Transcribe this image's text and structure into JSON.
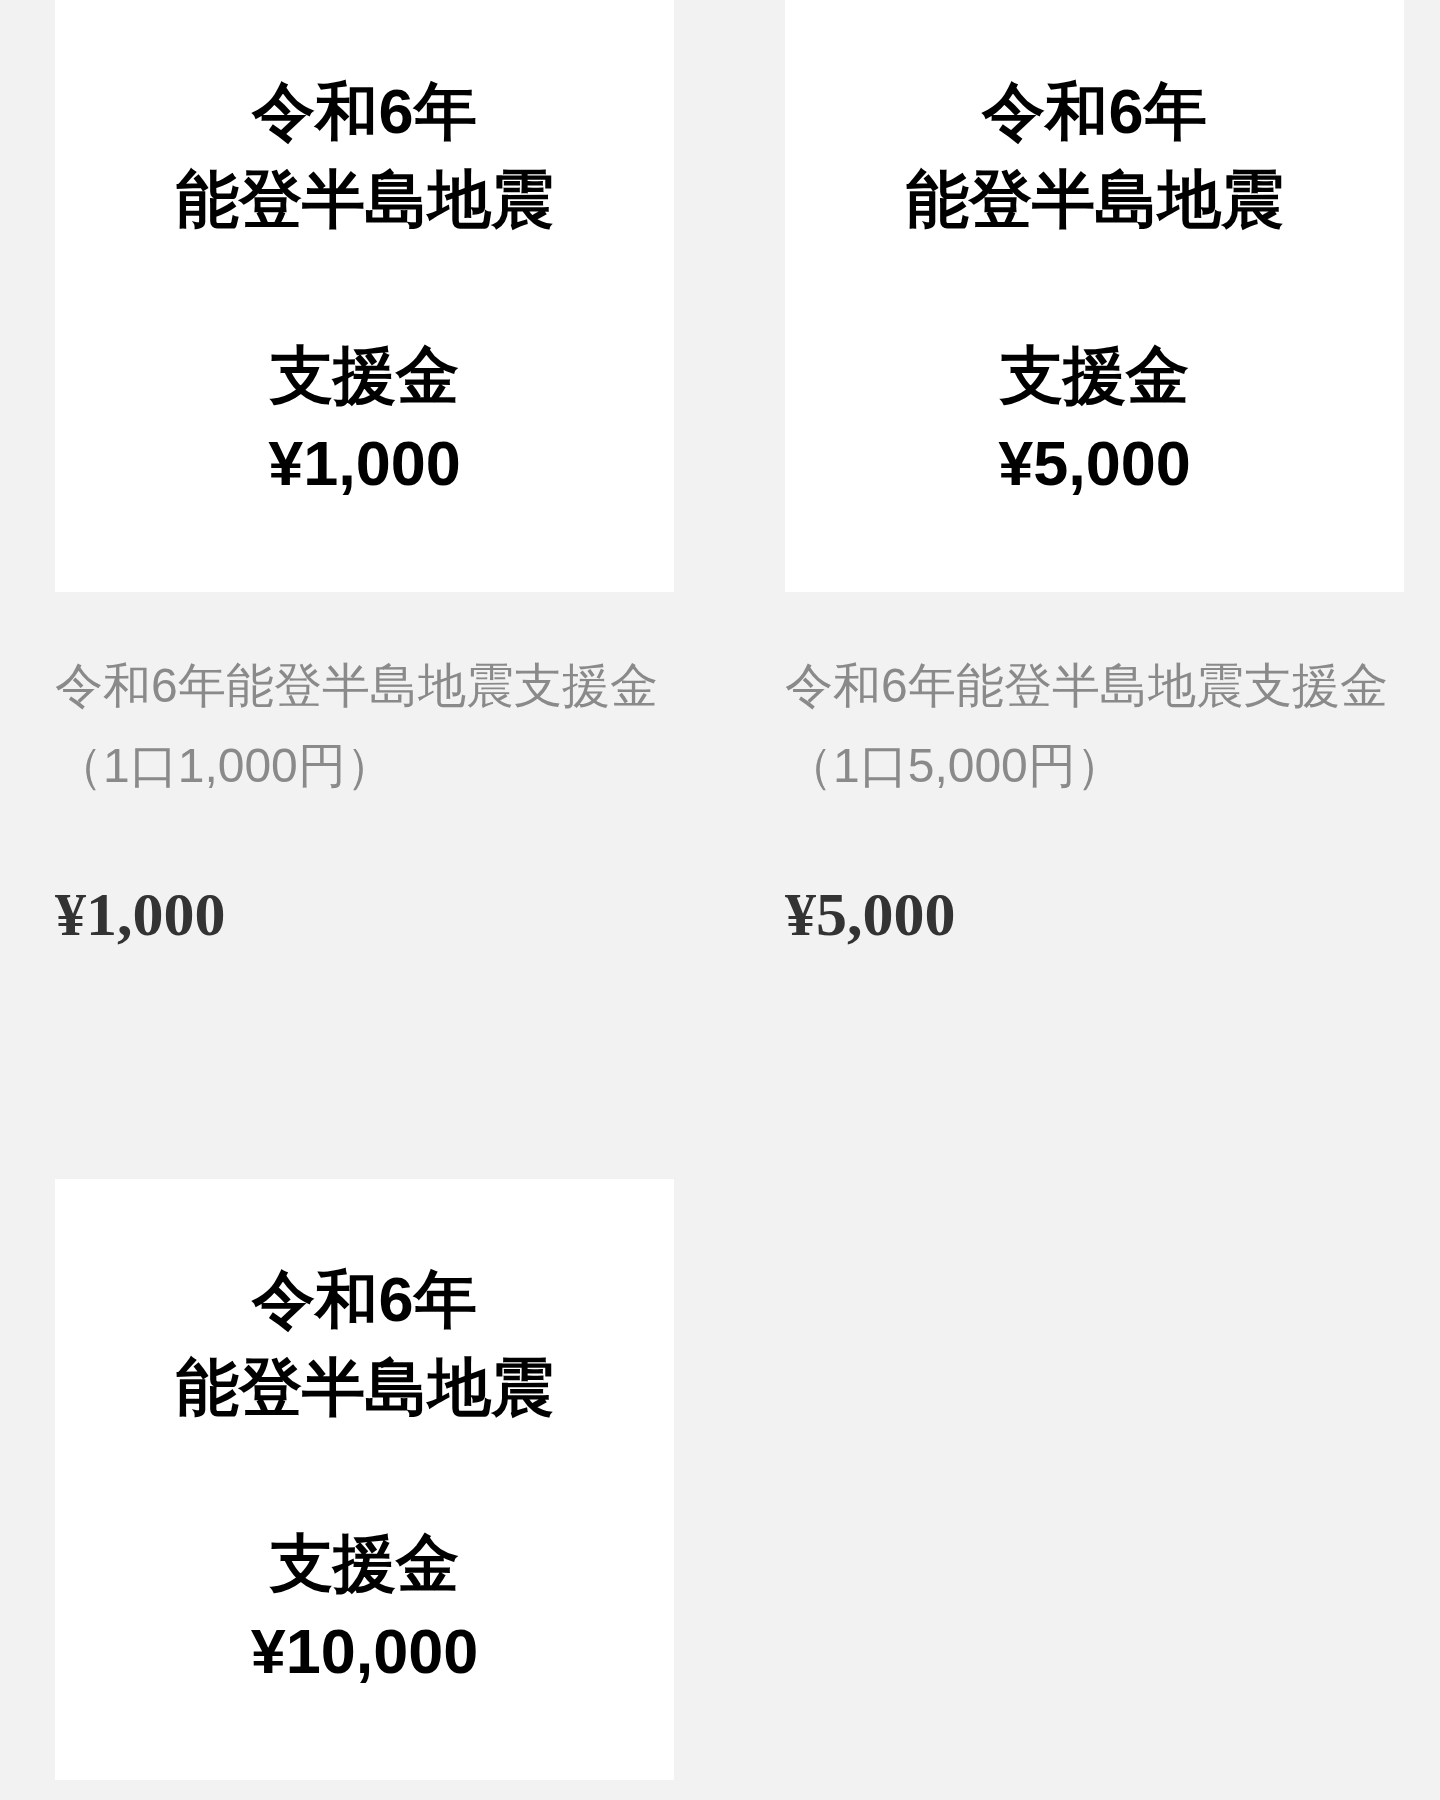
{
  "products": [
    {
      "image_title": [
        "令和6年",
        "能登半島地震"
      ],
      "image_subtitle": "支援金",
      "image_price": "¥1,000",
      "name": "令和6年能登半島地震支援金（1口1,000円）",
      "price": "¥1,000"
    },
    {
      "image_title": [
        "令和6年",
        "能登半島地震"
      ],
      "image_subtitle": "支援金",
      "image_price": "¥5,000",
      "name": "令和6年能登半島地震支援金（1口5,000円）",
      "price": "¥5,000"
    },
    {
      "image_title": [
        "令和6年",
        "能登半島地震"
      ],
      "image_subtitle": "支援金",
      "image_price": "¥10,000"
    }
  ]
}
